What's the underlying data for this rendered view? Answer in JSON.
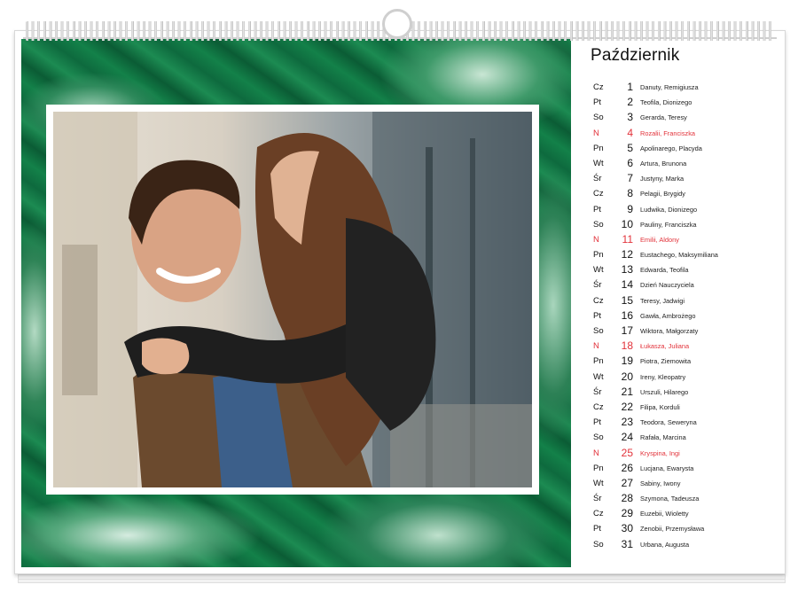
{
  "calendar": {
    "month": "Październik",
    "days": [
      {
        "d": "Cz",
        "n": "1",
        "names": "Danuty, Remigiusza",
        "sun": false
      },
      {
        "d": "Pt",
        "n": "2",
        "names": "Teofila, Dionizego",
        "sun": false
      },
      {
        "d": "So",
        "n": "3",
        "names": "Gerarda, Teresy",
        "sun": false
      },
      {
        "d": "N",
        "n": "4",
        "names": "Rozalii, Franciszka",
        "sun": true
      },
      {
        "d": "Pn",
        "n": "5",
        "names": "Apolinarego, Placyda",
        "sun": false
      },
      {
        "d": "Wt",
        "n": "6",
        "names": "Artura, Brunona",
        "sun": false
      },
      {
        "d": "Śr",
        "n": "7",
        "names": "Justyny, Marka",
        "sun": false
      },
      {
        "d": "Cz",
        "n": "8",
        "names": "Pelagii, Brygidy",
        "sun": false
      },
      {
        "d": "Pt",
        "n": "9",
        "names": "Ludwika, Dionizego",
        "sun": false
      },
      {
        "d": "So",
        "n": "10",
        "names": "Pauliny, Franciszka",
        "sun": false
      },
      {
        "d": "N",
        "n": "11",
        "names": "Emilii, Aldony",
        "sun": true
      },
      {
        "d": "Pn",
        "n": "12",
        "names": "Eustachego, Maksymiliana",
        "sun": false
      },
      {
        "d": "Wt",
        "n": "13",
        "names": "Edwarda, Teofila",
        "sun": false
      },
      {
        "d": "Śr",
        "n": "14",
        "names": "Dzień Nauczyciela",
        "sun": false
      },
      {
        "d": "Cz",
        "n": "15",
        "names": "Teresy, Jadwigi",
        "sun": false
      },
      {
        "d": "Pt",
        "n": "16",
        "names": "Gawła, Ambrożego",
        "sun": false
      },
      {
        "d": "So",
        "n": "17",
        "names": "Wiktora, Małgorzaty",
        "sun": false
      },
      {
        "d": "N",
        "n": "18",
        "names": "Łukasza, Juliana",
        "sun": true
      },
      {
        "d": "Pn",
        "n": "19",
        "names": "Piotra, Ziemowita",
        "sun": false
      },
      {
        "d": "Wt",
        "n": "20",
        "names": "Ireny, Kleopatry",
        "sun": false
      },
      {
        "d": "Śr",
        "n": "21",
        "names": "Urszuli, Hilarego",
        "sun": false
      },
      {
        "d": "Cz",
        "n": "22",
        "names": "Filipa, Korduli",
        "sun": false
      },
      {
        "d": "Pt",
        "n": "23",
        "names": "Teodora, Seweryna",
        "sun": false
      },
      {
        "d": "So",
        "n": "24",
        "names": "Rafała, Marcina",
        "sun": false
      },
      {
        "d": "N",
        "n": "25",
        "names": "Kryspina, Ingi",
        "sun": true
      },
      {
        "d": "Pn",
        "n": "26",
        "names": "Lucjana, Ewarysta",
        "sun": false
      },
      {
        "d": "Wt",
        "n": "27",
        "names": "Sabiny, Iwony",
        "sun": false
      },
      {
        "d": "Śr",
        "n": "28",
        "names": "Szymona, Tadeusza",
        "sun": false
      },
      {
        "d": "Cz",
        "n": "29",
        "names": "Euzebii, Wioletty",
        "sun": false
      },
      {
        "d": "Pt",
        "n": "30",
        "names": "Zenobii, Przemysława",
        "sun": false
      },
      {
        "d": "So",
        "n": "31",
        "names": "Urbana, Augusta",
        "sun": false
      }
    ]
  },
  "colors": {
    "sunday": "#e2323a",
    "marble_green": "#138149",
    "text": "#111111"
  },
  "icons": {
    "hanger": "hanger-ring-icon",
    "binding": "spiral-binding-icon"
  }
}
